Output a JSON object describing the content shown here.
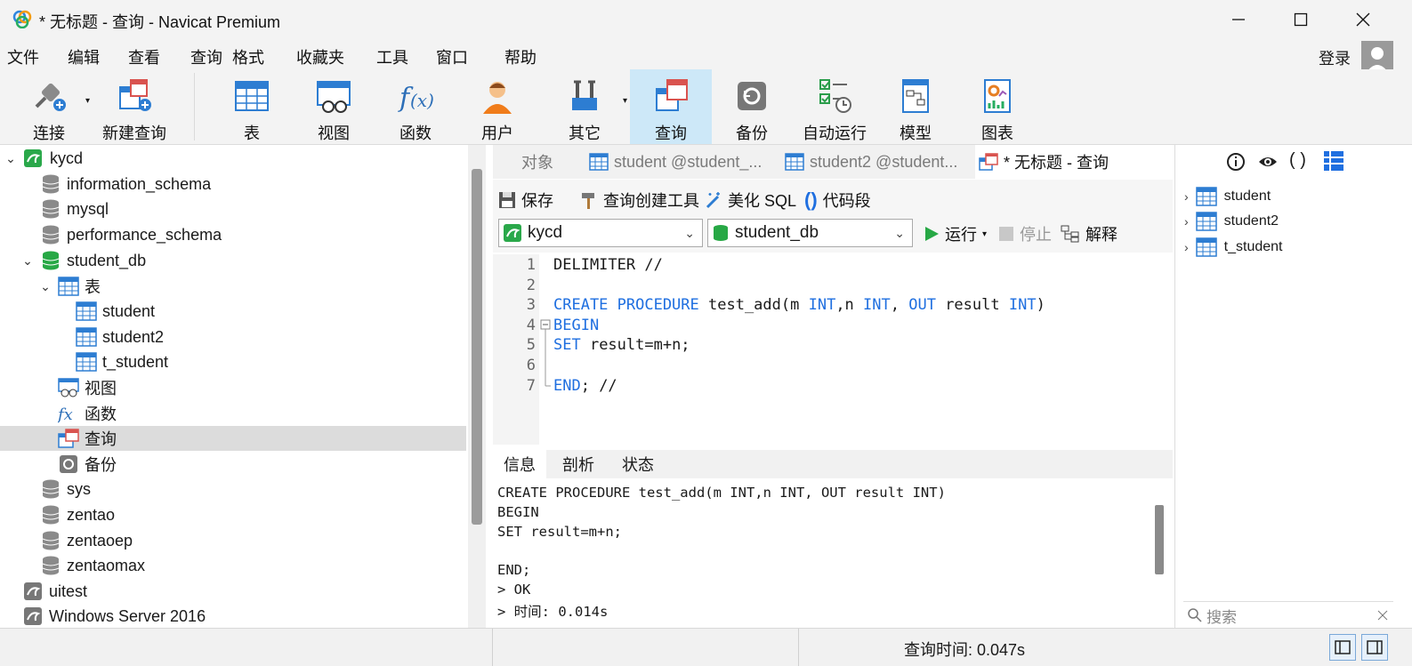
{
  "window": {
    "title": "* 无标题 - 查询 - Navicat Premium",
    "minimize": "—",
    "maximize": "☐",
    "close": "✕"
  },
  "menu": [
    "文件",
    "编辑",
    "查看",
    "查询",
    "格式",
    "收藏夹",
    "工具",
    "窗口",
    "帮助"
  ],
  "account": {
    "login_label": "登录"
  },
  "toolbar": {
    "connect": "连接",
    "new_query": "新建查询",
    "table": "表",
    "view": "视图",
    "function": "函数",
    "user": "用户",
    "other": "其它",
    "query": "查询",
    "backup": "备份",
    "auto_run": "自动运行",
    "model": "模型",
    "chart": "图表"
  },
  "tree": {
    "connection": "kycd",
    "databases": [
      "information_schema",
      "mysql",
      "performance_schema"
    ],
    "open_db": "student_db",
    "tables_group": "表",
    "tables": [
      "student",
      "student2",
      "t_student"
    ],
    "views_group": "视图",
    "functions_group": "函数",
    "queries_group": "查询",
    "backups_group": "备份",
    "more_dbs": [
      "sys",
      "zentao",
      "zentaoep",
      "zentaomax"
    ],
    "other_connections": [
      "uitest",
      "Windows Server 2016"
    ]
  },
  "tabs": {
    "objects": "对象",
    "tab1": "student @student_...",
    "tab2": "student2 @student...",
    "tab3": "* 无标题 - 查询"
  },
  "query_toolbar": {
    "save": "保存",
    "builder": "查询创建工具",
    "beautify": "美化 SQL",
    "snippet": "代码段",
    "run": "运行",
    "stop": "停止",
    "explain": "解释"
  },
  "selectors": {
    "connection": "kycd",
    "database": "student_db"
  },
  "editor": {
    "line_numbers": [
      "1",
      "2",
      "3",
      "4",
      "5",
      "6",
      "7"
    ],
    "l1": "DELIMITER //",
    "l3_kw1": "CREATE PROCEDURE",
    "l3_name": " test_add(m ",
    "l3_int1": "INT",
    "l3_mid": ",n ",
    "l3_int2": "INT",
    "l3_comma": ", ",
    "l3_out": "OUT",
    "l3_result": " result ",
    "l3_int3": "INT",
    "l3_end": ")",
    "l4": "BEGIN",
    "l5_kw": "SET",
    "l5_rest": " result=m+n;",
    "l7_kw": "END",
    "l7_rest": "; //"
  },
  "result_tabs": [
    "信息",
    "剖析",
    "状态"
  ],
  "result_log": [
    "CREATE PROCEDURE test_add(m INT,n INT, OUT result INT)",
    "BEGIN",
    "SET result=m+n;",
    "",
    "END;",
    "> OK",
    "> 时间: 0.014s"
  ],
  "right_panel": {
    "tables": [
      "student",
      "student2",
      "t_student"
    ],
    "search_placeholder": "搜索"
  },
  "status": {
    "query_time": "查询时间: 0.047s"
  },
  "colors": {
    "accent": "#1f6fe0",
    "selected_bg": "#dcdcdc",
    "toolbar_active": "#cde8f8"
  }
}
